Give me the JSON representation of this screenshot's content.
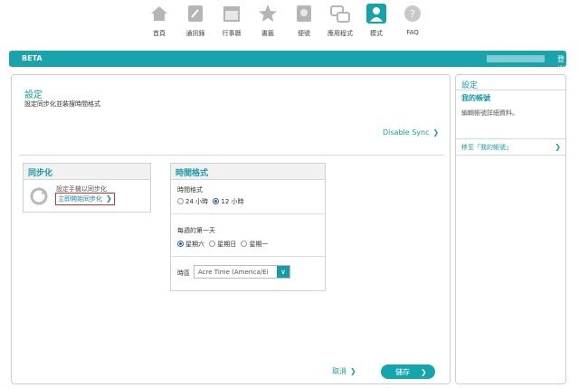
{
  "nav": {
    "items": [
      {
        "label": "首頁",
        "icon": "home-icon"
      },
      {
        "label": "通訊錄",
        "icon": "contacts-icon"
      },
      {
        "label": "行事曆",
        "icon": "calendar-icon"
      },
      {
        "label": "書籤",
        "icon": "star-icon"
      },
      {
        "label": "便號",
        "icon": "notes-icon"
      },
      {
        "label": "應用程式",
        "icon": "apps-icon"
      },
      {
        "label": "模式",
        "icon": "profile-icon"
      },
      {
        "label": "FAQ",
        "icon": "help-icon"
      }
    ]
  },
  "bar": {
    "beta": "BETA",
    "logout": "登出"
  },
  "main": {
    "title": "設定",
    "subtitle": "設定同步化並裝搜時間格式",
    "disable_sync": "Disable Sync"
  },
  "sync_panel": {
    "title": "同步化",
    "desc": "設定手機以同步化",
    "link": "立即開始同步化"
  },
  "time_panel": {
    "title": "時間格式",
    "format_label": "時間格式",
    "opt_24": "24 小時",
    "opt_12": "12 小時",
    "selected_format": "12 小時",
    "week_label": "每週的第一天",
    "opt_sat": "星期六",
    "opt_sun": "星期日",
    "opt_mon": "星期一",
    "selected_week": "星期六",
    "tz_label": "時區",
    "tz_value": "Acre Time (America/Ei"
  },
  "actions": {
    "cancel": "取消",
    "save": "儲存"
  },
  "sidebar": {
    "title": "設定",
    "account_title": "我的帳號",
    "account_desc": "編輯帳號詳細資料。",
    "goto_link": "移至「我的帳號」"
  },
  "colors": {
    "accent": "#1ba3ab",
    "link_highlight": "#d9302c"
  }
}
